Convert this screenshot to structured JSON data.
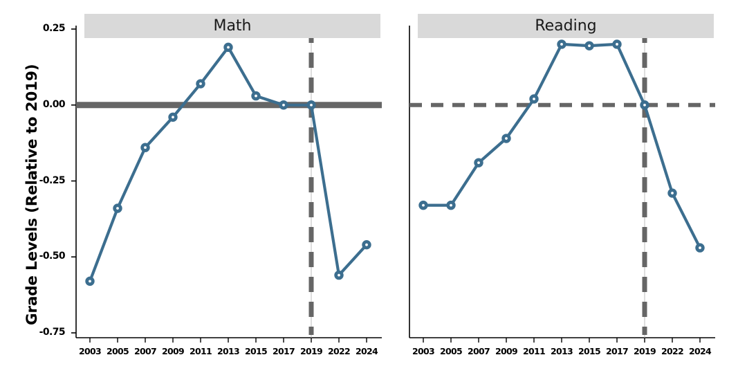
{
  "axis": {
    "ylabel": "Grade Levels (Relative to 2019)",
    "y_ticks": [
      "0.25",
      "0.00",
      "-0.25",
      "-0.50",
      "-0.75"
    ],
    "y_tick_values": [
      0.25,
      0,
      -0.25,
      -0.5,
      -0.75
    ],
    "x_ticks": [
      "2003",
      "2005",
      "2007",
      "2009",
      "2011",
      "2013",
      "2015",
      "2017",
      "2019",
      "2022",
      "2024"
    ]
  },
  "style": {
    "series_color": "#3c6e8f",
    "reference_line_color": "#666666",
    "panel_header_bg": "#d9d9d9",
    "axis_color": "#000000",
    "marker_fill": "#ffffff"
  },
  "chart_data": {
    "type": "line",
    "title": "",
    "xlabel": "",
    "ylabel": "Grade Levels (Relative to 2019)",
    "ylim": [
      -0.75,
      0.25
    ],
    "grid": false,
    "legend": "none",
    "panels": [
      {
        "label": "Math",
        "x": [
          "2003",
          "2005",
          "2007",
          "2009",
          "2011",
          "2013",
          "2015",
          "2017",
          "2019",
          "2022",
          "2024"
        ],
        "values": [
          -0.58,
          -0.34,
          -0.14,
          -0.04,
          0.07,
          0.19,
          0.03,
          0.0,
          0.0,
          -0.56,
          -0.46
        ],
        "annotations": {
          "vline_x": "2019",
          "hline_y": 0.0
        }
      },
      {
        "label": "Reading",
        "x": [
          "2003",
          "2005",
          "2007",
          "2009",
          "2011",
          "2013",
          "2015",
          "2017",
          "2019",
          "2022",
          "2024"
        ],
        "values": [
          -0.33,
          -0.33,
          -0.19,
          -0.11,
          0.02,
          0.2,
          0.195,
          0.2,
          0.0,
          -0.29,
          -0.47
        ],
        "annotations": {
          "vline_x": "2019",
          "hline_y": 0.0
        }
      }
    ]
  }
}
